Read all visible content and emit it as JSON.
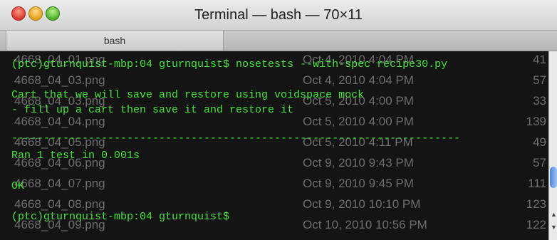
{
  "window": {
    "title": "Terminal — bash — 70×11"
  },
  "tabs": [
    {
      "label": "bash"
    }
  ],
  "terminal": {
    "lines": [
      "(ptc)gturnquist-mbp:04 gturnquist$ nosetests --with-spec recipe30.py",
      "",
      "Cart that we will save and restore using voidspace mock",
      "- fill up a cart then save it and restore it",
      "",
      "----------------------------------------------------------------------",
      "Ran 1 test in 0.001s",
      "",
      "OK",
      "",
      "(ptc)gturnquist-mbp:04 gturnquist$"
    ],
    "background_listing": [
      {
        "name": "4668_04_01.png",
        "date": "Oct 4, 2010 4:04 PM",
        "size": "41"
      },
      {
        "name": "4668_04_03.png",
        "date": "Oct 4, 2010 4:04 PM",
        "size": "57"
      },
      {
        "name": "4668_04_03.png",
        "date": "Oct 5, 2010 4:00 PM",
        "size": "33"
      },
      {
        "name": "4668_04_04.png",
        "date": "Oct 5, 2010 4:00 PM",
        "size": "139"
      },
      {
        "name": "4668_04_05.png",
        "date": "Oct 5, 2010 4:11 PM",
        "size": "49"
      },
      {
        "name": "4668_04_06.png",
        "date": "Oct 9, 2010 9:43 PM",
        "size": "57"
      },
      {
        "name": "4668_04_07.png",
        "date": "Oct 9, 2010 9:45 PM",
        "size": "111"
      },
      {
        "name": "4668_04_08.png",
        "date": "Oct 9, 2010 10:10 PM",
        "size": "123"
      },
      {
        "name": "4668_04_09.png",
        "date": "Oct 10, 2010 10:56 PM",
        "size": "122"
      }
    ]
  },
  "colors": {
    "terminal_text": "#45e33c",
    "terminal_bg": "#141414",
    "ghost_text": "#6e6e6e"
  }
}
